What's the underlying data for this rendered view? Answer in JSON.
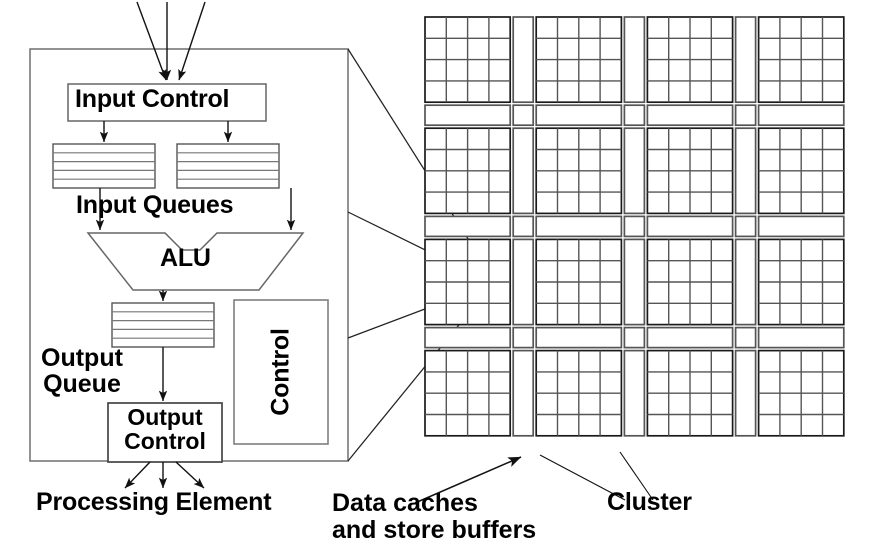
{
  "figure": {
    "kind": "architecture-diagram",
    "title_absent": true
  },
  "processing_element": {
    "outer_label": "Processing Element",
    "blocks": {
      "input_control": "Input Control",
      "input_queues": "Input Queues",
      "alu": "ALU",
      "output_queue": "Output\nQueue",
      "output_queue_line1": "Output",
      "output_queue_line2": "Queue",
      "output_control_line1": "Output",
      "output_control_line2": "Control",
      "control": "Control"
    },
    "queue_stripe_count": 5,
    "input_arrow_count": 3,
    "output_arrow_count": 3
  },
  "array": {
    "cluster_label": "Cluster",
    "cache_label_line1": "Data caches",
    "cache_label_line2": "and store buffers",
    "clusters_across": 4,
    "clusters_down": 4,
    "pes_per_cluster_across": 4,
    "pes_per_cluster_down": 4,
    "total_clusters": 16,
    "total_pes": 256
  },
  "colors": {
    "ink": "#000000",
    "line_dark": "#1a1a1a",
    "line_mid": "#555555",
    "line_light": "#8c8c8c",
    "background": "#ffffff"
  }
}
